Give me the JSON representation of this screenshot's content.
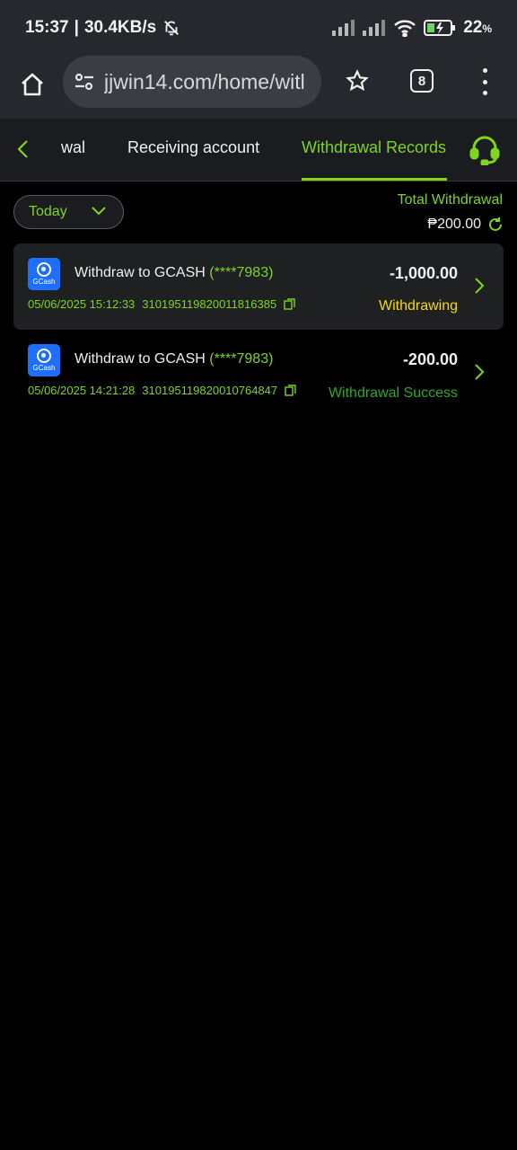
{
  "status_bar": {
    "time": "15:37",
    "separator": "|",
    "net_speed": "30.4KB/s",
    "battery_percent": "22",
    "battery_unit": "%"
  },
  "browser": {
    "url": "jjwin14.com/home/witl",
    "tab_count": "8"
  },
  "tabs": {
    "partial_label": "wal",
    "receiving_label": "Receiving account",
    "records_label": "Withdrawal Records",
    "active": "Withdrawal Records"
  },
  "filter": {
    "selected": "Today"
  },
  "summary": {
    "total_label": "Total Withdrawal",
    "total_amount": "₱200.00"
  },
  "records": [
    {
      "title": "Withdraw to GCASH",
      "account": "(****7983)",
      "datetime": "05/06/2025 15:12:33",
      "order_id": "310195119820011816385",
      "amount": "-1,000.00",
      "status": "Withdrawing"
    },
    {
      "title": "Withdraw to GCASH",
      "account": "(****7983)",
      "datetime": "05/06/2025 14:21:28",
      "order_id": "310195119820010764847",
      "amount": "-200.00",
      "status": "Withdrawal Success"
    }
  ],
  "logo": {
    "text": "GCash"
  },
  "colors": {
    "accent": "#7fd41d",
    "pending": "#f5d90f",
    "success": "#2ea822",
    "background": "#000000",
    "card": "#1f2022"
  }
}
